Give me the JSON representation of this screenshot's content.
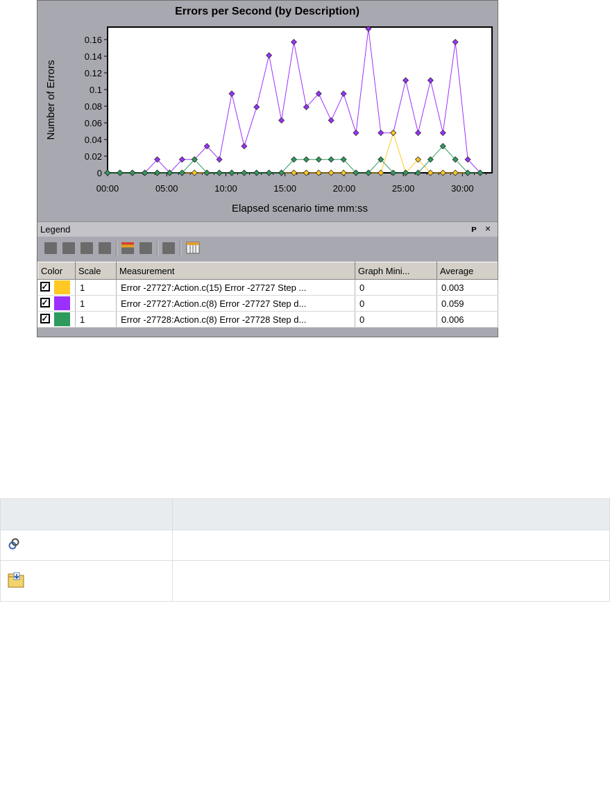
{
  "chart_data": {
    "type": "line",
    "title": "Errors per Second (by Description)",
    "xlabel": "Elapsed scenario time mm:ss",
    "ylabel": "Number of Errors",
    "x_tick_labels": [
      "00:00",
      "05:00",
      "10:00",
      "15:00",
      "20:00",
      "25:00",
      "30:00"
    ],
    "x_tick_values_min": [
      0,
      5,
      10,
      15,
      20,
      25,
      30
    ],
    "y_tick_labels": [
      "0",
      "0.02",
      "0.04",
      "0.06",
      "0.08",
      "0.1",
      "0.12",
      "0.14",
      "0.16"
    ],
    "xlim_min": [
      0,
      32.5
    ],
    "ylim": [
      0,
      0.175
    ],
    "x_minutes": [
      0,
      1,
      2,
      3,
      4,
      5,
      6,
      7,
      8,
      9,
      10,
      11,
      12,
      13,
      14,
      15,
      16,
      17,
      18,
      19,
      20,
      21,
      22,
      23,
      24,
      25,
      26,
      27,
      28,
      29,
      30,
      31,
      32
    ],
    "series": [
      {
        "name": "Error -27727:Action.c(8) Error -27727 Step d...",
        "color": "#9b30ff",
        "values": [
          0,
          0,
          0,
          0,
          0.016,
          0,
          0.016,
          0.016,
          0.032,
          0.016,
          0.095,
          0.032,
          0.079,
          0.141,
          0.063,
          0.157,
          0.079,
          0.095,
          0.063,
          0.095,
          0.048,
          0.173,
          0.048,
          0.048,
          0.111,
          0.048,
          0.111,
          0.048,
          0.157,
          0.016,
          0
        ]
      },
      {
        "name": "Error -27727:Action.c(15) Error -27727 Step ...",
        "color": "#ffc824",
        "values": [
          0,
          0,
          0,
          0,
          0,
          0,
          0,
          0,
          0,
          0,
          0,
          0,
          0,
          0,
          0,
          0,
          0,
          0,
          0,
          0,
          0,
          0,
          0,
          0.048,
          0,
          0.016,
          0,
          0,
          0,
          0,
          0
        ]
      },
      {
        "name": "Error -27728:Action.c(8) Error -27728 Step d...",
        "color": "#2e9a5c",
        "values": [
          0,
          0,
          0,
          0,
          0,
          0,
          0,
          0.016,
          0,
          0,
          0,
          0,
          0,
          0,
          0,
          0.016,
          0.016,
          0.016,
          0.016,
          0.016,
          0,
          0,
          0.016,
          0,
          0,
          0,
          0.016,
          0.032,
          0.016,
          0,
          0
        ]
      }
    ],
    "x_points_min": [
      0,
      1.05,
      2.1,
      3.15,
      4.2,
      5.25,
      6.3,
      7.35,
      8.4,
      9.45,
      10.5,
      11.55,
      12.6,
      13.65,
      14.7,
      15.75,
      16.8,
      17.85,
      18.9,
      19.95,
      21,
      22.05,
      23.1,
      24.15,
      25.2,
      26.25,
      27.3,
      28.35,
      29.4,
      30.45,
      31.5
    ],
    "grid": false,
    "legend": "table-below"
  },
  "legend_panel": {
    "title": "Legend",
    "pin": "ᵖ",
    "close": "×",
    "columns": [
      "Color",
      "Scale",
      "Measurement",
      "Graph Mini...",
      "Average"
    ],
    "rows": [
      {
        "color": "#ffc824",
        "checked": "☑",
        "scale": "1",
        "measurement": "Error -27727:Action.c(15) Error -27727 Step ...",
        "graph_min": "0",
        "average": "0.003"
      },
      {
        "color": "#9b30ff",
        "checked": "☑",
        "scale": "1",
        "measurement": "Error -27727:Action.c(8) Error -27727 Step d...",
        "graph_min": "0",
        "average": "0.059"
      },
      {
        "color": "#2e9a5c",
        "checked": "☑",
        "scale": "1",
        "measurement": "Error -27728:Action.c(8) Error -27728 Step d...",
        "graph_min": "0",
        "average": "0.006"
      }
    ]
  },
  "ref_table": {
    "rows": [
      {
        "icon": "link-icon"
      },
      {
        "icon": "folder-import-icon"
      }
    ]
  }
}
